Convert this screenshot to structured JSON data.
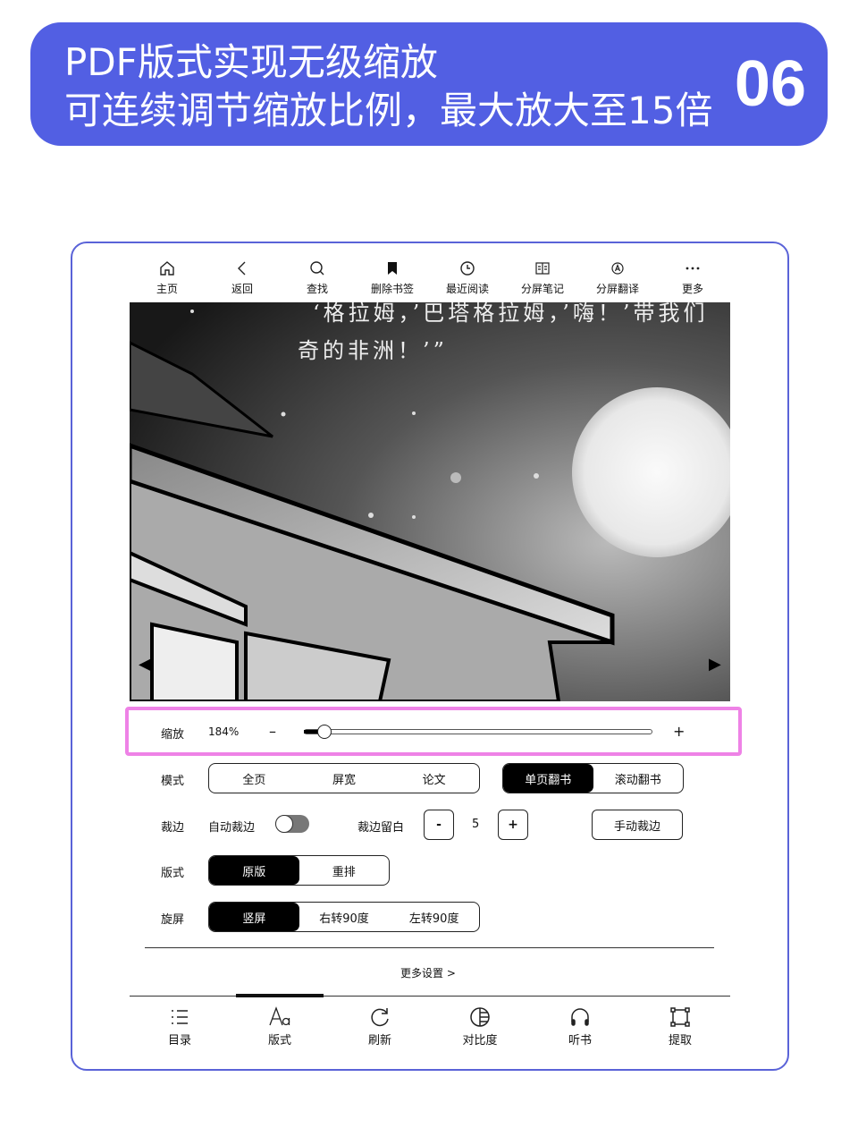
{
  "banner": {
    "line1": "PDF版式实现无级缩放",
    "line2": "可连续调节缩放比例，最大放大至15倍",
    "number": "06",
    "color": "#525fe3"
  },
  "topbar": [
    {
      "icon": "home-icon",
      "label": "主页"
    },
    {
      "icon": "back-icon",
      "label": "返回"
    },
    {
      "icon": "search-icon",
      "label": "查找"
    },
    {
      "icon": "bookmark-icon",
      "label": "删除书签"
    },
    {
      "icon": "clock-icon",
      "label": "最近阅读"
    },
    {
      "icon": "split-notes-icon",
      "label": "分屏笔记"
    },
    {
      "icon": "translate-icon",
      "label": "分屏翻译"
    },
    {
      "icon": "more-icon",
      "label": "更多"
    }
  ],
  "page": {
    "line1": "‘格拉姆，’巴塔格拉姆，’嗨！’带我们",
    "line2": "奇的非洲！’”"
  },
  "zoom": {
    "label": "缩放",
    "value": "184%",
    "minus": "–",
    "plus": "+",
    "slider_fraction": 0.02,
    "highlight": "#ee82e6"
  },
  "mode": {
    "label": "模式",
    "options": [
      "全页",
      "屏宽",
      "论文"
    ],
    "flip_options": [
      "单页翻书",
      "滚动翻书"
    ],
    "flip_selected": 0
  },
  "crop": {
    "label": "裁边",
    "auto_label": "自动裁边",
    "auto_on": false,
    "margin_label": "裁边留白",
    "minus": "-",
    "value": "5",
    "plus": "+",
    "manual": "手动裁边"
  },
  "layout": {
    "label": "版式",
    "options": [
      "原版",
      "重排"
    ],
    "selected": 0
  },
  "rotate": {
    "label": "旋屏",
    "options": [
      "竖屏",
      "右转90度",
      "左转90度"
    ],
    "selected": 0
  },
  "more_settings": "更多设置 >",
  "bottombar": [
    {
      "icon": "toc-icon",
      "label": "目录"
    },
    {
      "icon": "font-icon",
      "label": "版式",
      "active": true
    },
    {
      "icon": "refresh-icon",
      "label": "刷新"
    },
    {
      "icon": "contrast-icon",
      "label": "对比度"
    },
    {
      "icon": "headphones-icon",
      "label": "听书"
    },
    {
      "icon": "extract-icon",
      "label": "提取"
    }
  ]
}
